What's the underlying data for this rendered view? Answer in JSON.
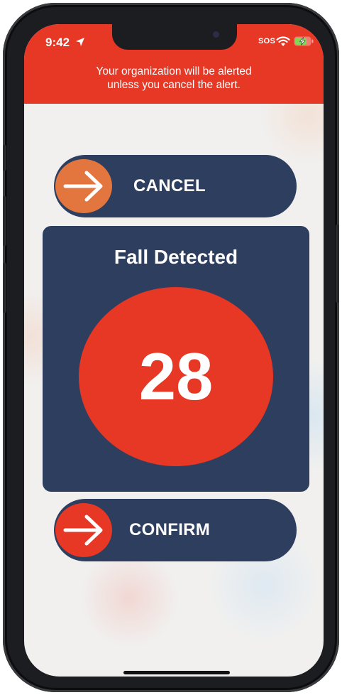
{
  "status_bar": {
    "time": "9:42",
    "sos": "SOS"
  },
  "header": {
    "alert_line1": "Your organization will be alerted",
    "alert_line2": "unless you cancel the alert."
  },
  "cancel_button": {
    "label": "CANCEL"
  },
  "alert_card": {
    "title": "Fall Detected",
    "countdown": "28"
  },
  "confirm_button": {
    "label": "CONFIRM"
  },
  "colors": {
    "alert_red": "#e73725",
    "navy": "#2d3e5e",
    "cancel_orange": "#e2763e",
    "background": "#f1f0ef"
  },
  "icons": {
    "cancel_knob": "arrow-right-icon",
    "confirm_knob": "arrow-right-icon",
    "status": [
      "location-arrow-icon",
      "wifi-icon",
      "battery-charging-icon"
    ]
  }
}
